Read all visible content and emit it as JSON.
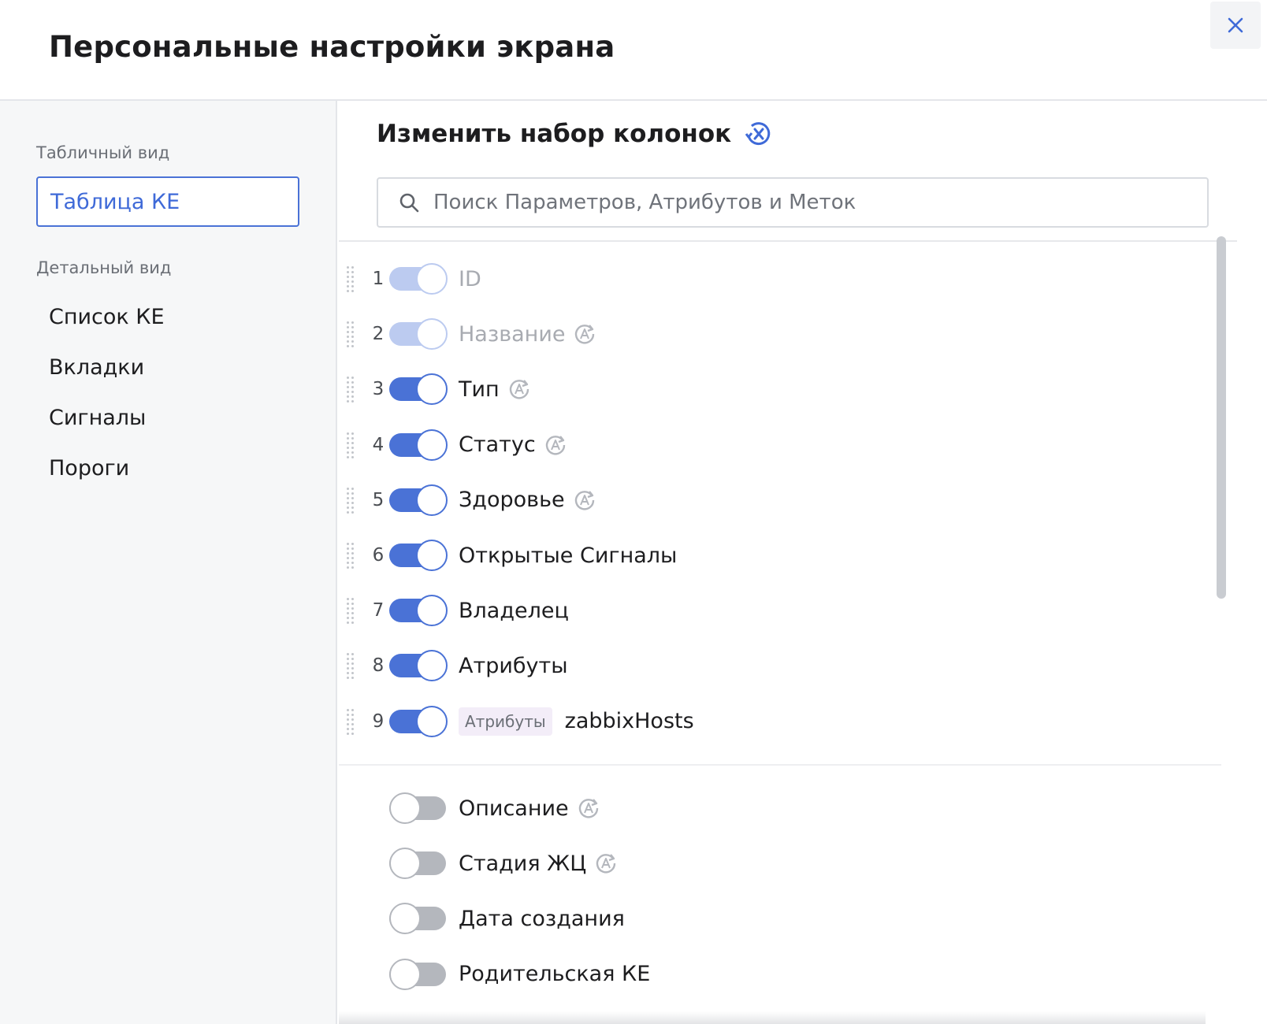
{
  "header": {
    "title": "Персональные настройки экрана"
  },
  "sidebar": {
    "table_view_label": "Табличный вид",
    "table_items": [
      {
        "label": "Таблица КЕ",
        "active": true
      }
    ],
    "detail_view_label": "Детальный вид",
    "detail_items": [
      {
        "label": "Список КЕ"
      },
      {
        "label": "Вкладки"
      },
      {
        "label": "Сигналы"
      },
      {
        "label": "Пороги"
      }
    ]
  },
  "main": {
    "title": "Изменить набор колонок",
    "search": {
      "placeholder": "Поиск Параметров, Атрибутов и Меток",
      "value": ""
    },
    "enabled_columns": [
      {
        "num": "1",
        "label": "ID",
        "on": true,
        "locked": true,
        "auto": false
      },
      {
        "num": "2",
        "label": "Название",
        "on": true,
        "locked": true,
        "auto": true
      },
      {
        "num": "3",
        "label": "Тип",
        "on": true,
        "locked": false,
        "auto": true
      },
      {
        "num": "4",
        "label": "Статус",
        "on": true,
        "locked": false,
        "auto": true
      },
      {
        "num": "5",
        "label": "Здоровье",
        "on": true,
        "locked": false,
        "auto": true
      },
      {
        "num": "6",
        "label": "Открытые Сигналы",
        "on": true,
        "locked": false,
        "auto": false
      },
      {
        "num": "7",
        "label": "Владелец",
        "on": true,
        "locked": false,
        "auto": false
      },
      {
        "num": "8",
        "label": "Атрибуты",
        "on": true,
        "locked": false,
        "auto": false
      },
      {
        "num": "9",
        "label": "zabbixHosts",
        "badge": "Атрибуты",
        "on": true,
        "locked": false,
        "auto": false
      }
    ],
    "disabled_columns": [
      {
        "label": "Описание",
        "on": false,
        "auto": true
      },
      {
        "label": "Стадия ЖЦ",
        "on": false,
        "auto": true
      },
      {
        "label": "Дата создания",
        "on": false,
        "auto": false
      },
      {
        "label": "Родительская КЕ",
        "on": false,
        "auto": false
      }
    ]
  },
  "colors": {
    "accent": "#4a72d6",
    "toggle_disabled": "#bccbf0",
    "toggle_off": "#b4b7bd",
    "badge_bg": "#f3edf8"
  },
  "icons": {
    "close": "close-icon",
    "reset": "reset-columns-icon",
    "search": "search-icon",
    "auto": "auto-attribute-icon",
    "drag": "drag-handle-icon"
  }
}
